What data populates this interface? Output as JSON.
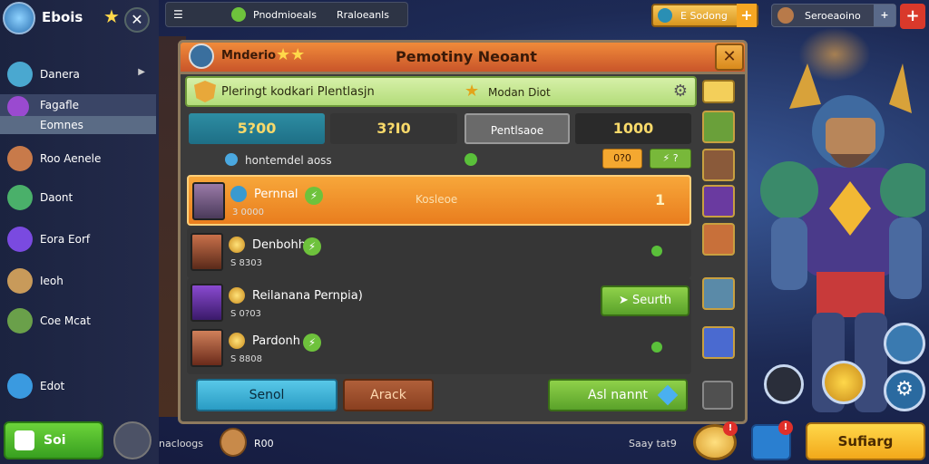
{
  "colors": {
    "accent_orange": "#e97d1e",
    "accent_green": "#5aa22a",
    "gold": "#f2a81a"
  },
  "profile": {
    "name": "Ebois"
  },
  "sidebar": {
    "items": [
      {
        "label": "Danera",
        "icon": "hero-icon"
      },
      {
        "label": "Fagafle",
        "icon": "potion-icon"
      },
      {
        "label": "Roo Aenele",
        "icon": "warrior-icon"
      },
      {
        "label": "Daont",
        "icon": "archer-icon"
      },
      {
        "label": "Eora Eorf",
        "icon": "orb-icon"
      },
      {
        "label": "Ieoh",
        "icon": "monk-icon"
      },
      {
        "label": "Coe Mcat",
        "icon": "ranger-icon"
      },
      {
        "label": "Edot",
        "icon": "chat-icon"
      }
    ],
    "sub_label": "Eomnes",
    "bottom_button": "Soi"
  },
  "topbar": {
    "label1": "Pnodmioeals",
    "label2": "Rraloeanls"
  },
  "currency": {
    "gold_label": "E Sodong",
    "right_label": "Seroeaoino"
  },
  "panel": {
    "tab_title": "Mnderio",
    "title": "Pemotiny Neoant",
    "banner": {
      "text": "Pleringt kodkari Plentlasjn",
      "right_text": "Modan Diot"
    },
    "stats": [
      "5?00",
      "3?I0",
      "Pentlsaoe",
      "1000"
    ],
    "stats_display": [
      "5?00",
      "3?I0",
      "Pentlsaoe",
      "1000"
    ],
    "subrow": {
      "text": "hontemdel aoss",
      "orange_btn": "0?0",
      "green_btn": "?"
    },
    "rows": [
      {
        "name": "Pernnal",
        "sub": "3 0000",
        "mid": "Kosleoe",
        "num": "1",
        "active": true
      },
      {
        "name": "Denbohh",
        "sub": "S 8303",
        "active": false
      },
      {
        "name": "Reilanana Pernpia)",
        "sub": "S 0?03",
        "button": "Seurth",
        "active": false
      },
      {
        "name": "Pardonh",
        "sub": "S 8808",
        "active": false
      }
    ],
    "actions": {
      "blue": "Senol",
      "brown": "Arack",
      "green": "Asl nannt"
    }
  },
  "bottombar": {
    "left_text": "nacloogs",
    "center_text": "R00",
    "right_text": "Saay tat9",
    "primary_button": "Sufiarg"
  }
}
